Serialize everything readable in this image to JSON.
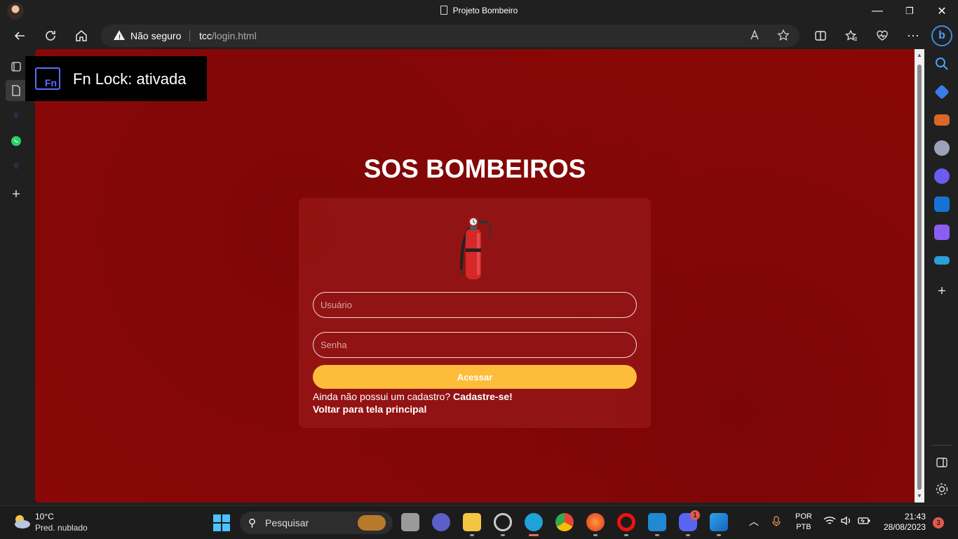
{
  "window": {
    "title": "Projeto Bombeiro",
    "minimize": "—",
    "restore": "❐",
    "close": "✕"
  },
  "toolbar": {
    "security_label": "Não seguro",
    "url_host": "tcc",
    "url_path": "/login.html",
    "more": "⋯"
  },
  "page": {
    "heading": "SOS BOMBEIROS",
    "username_placeholder": "Usuário",
    "password_placeholder": "Senha",
    "submit_label": "Acessar",
    "signup_prompt": "Ainda não possui um cadastro?",
    "signup_link": "Cadastre-se!",
    "back_link": "Voltar para tela principal",
    "background_color": "#8a0707",
    "button_color": "#fdbc3a"
  },
  "toast": {
    "icon_label": "Fn",
    "text": "Fn Lock: ativada"
  },
  "taskbar": {
    "weather_temp": "10°C",
    "weather_desc": "Pred. nublado",
    "search_placeholder": "Pesquisar",
    "discord_badge": "1",
    "lang_top": "POR",
    "lang_bottom": "PTB",
    "time": "21:43",
    "date": "28/08/2023",
    "notifications": "3"
  }
}
